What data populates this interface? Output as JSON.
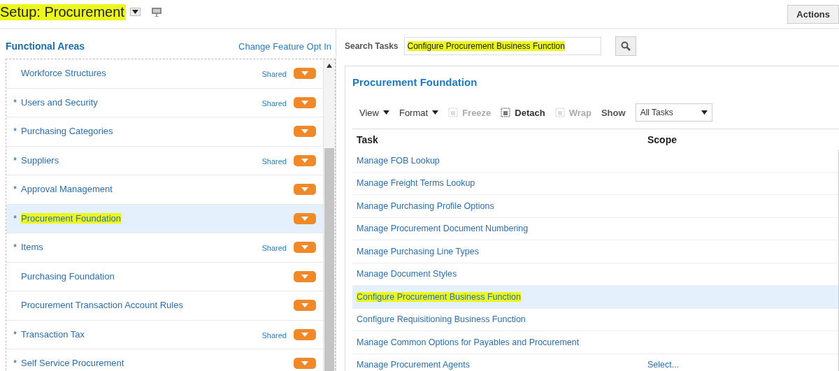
{
  "header": {
    "title": "Setup: Procurement",
    "highlighted": true,
    "actions": "Actions"
  },
  "functional_areas": {
    "heading": "Functional Areas",
    "link": "Change Feature Opt In",
    "items": [
      {
        "name": "Workforce Structures",
        "badge": "Shared",
        "selected": false,
        "highlighted": false
      },
      {
        "mark": "*",
        "name": "Users and Security",
        "badge": "Shared",
        "selected": false,
        "highlighted": false
      },
      {
        "mark": "*",
        "name": "Purchasing Categories",
        "selected": false,
        "highlighted": false
      },
      {
        "mark": "*",
        "name": "Suppliers",
        "badge": "Shared",
        "selected": false,
        "highlighted": false
      },
      {
        "mark": "*",
        "name": "Approval Management",
        "selected": false,
        "highlighted": false
      },
      {
        "mark": "*",
        "name": "Procurement Foundation",
        "selected": true,
        "highlighted": true
      },
      {
        "mark": "*",
        "name": "Items",
        "badge": "Shared",
        "selected": false,
        "highlighted": false
      },
      {
        "name": "Purchasing Foundation",
        "selected": false,
        "highlighted": false
      },
      {
        "name": "Procurement Transaction Account Rules",
        "selected": false,
        "highlighted": false
      },
      {
        "mark": "*",
        "name": "Transaction Tax",
        "badge": "Shared",
        "selected": false,
        "highlighted": false
      },
      {
        "mark": "*",
        "name": "Self Service Procurement",
        "selected": false,
        "highlighted": false
      }
    ]
  },
  "search": {
    "label": "Search Tasks",
    "value": "Configure Procurement Business Function",
    "highlighted": true
  },
  "tasks": {
    "title": "Procurement Foundation",
    "toolbar": [
      {
        "kind": "menu",
        "label": "View"
      },
      {
        "kind": "menu",
        "label": "Format"
      },
      {
        "kind": "tool",
        "label": "Freeze",
        "disabled": true
      },
      {
        "kind": "tool",
        "label": "Detach",
        "disabled": false
      },
      {
        "kind": "tool",
        "label": "Wrap",
        "disabled": true
      },
      {
        "kind": "select",
        "label": "Show",
        "value": "All Tasks"
      }
    ],
    "columns": [
      "Task",
      "Scope"
    ],
    "rows": [
      {
        "task": "Manage FOB Lookup",
        "selected": false,
        "highlighted": false
      },
      {
        "task": "Manage Freight Terms Lookup",
        "selected": false,
        "highlighted": false
      },
      {
        "task": "Manage Purchasing Profile Options",
        "selected": false,
        "highlighted": false
      },
      {
        "task": "Manage Procurement Document Numbering",
        "selected": false,
        "highlighted": false
      },
      {
        "task": "Manage Purchasing Line Types",
        "selected": false,
        "highlighted": false
      },
      {
        "task": "Manage Document Styles",
        "selected": false,
        "highlighted": false
      },
      {
        "task": "Configure Procurement Business Function",
        "selected": true,
        "highlighted": true
      },
      {
        "task": "Configure Requisitioning Business Function",
        "selected": false,
        "highlighted": false
      },
      {
        "task": "Manage Common Options for Payables and Procurement",
        "selected": false,
        "highlighted": false
      },
      {
        "task": "Manage Procurement Agents",
        "scope": "Select...",
        "selected": false,
        "highlighted": false
      }
    ]
  }
}
